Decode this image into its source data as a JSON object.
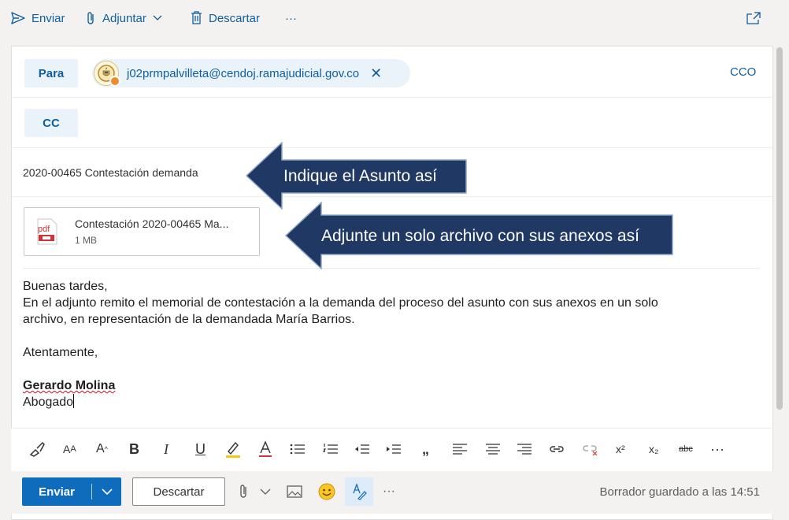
{
  "toolbar": {
    "send": "Enviar",
    "attach": "Adjuntar",
    "discard": "Descartar",
    "more": "···"
  },
  "recipients": {
    "to_label": "Para",
    "cc_label": "CC",
    "bcc_label": "CCO",
    "to_email": "j02prmpalvilleta@cendoj.ramajudicial.gov.co",
    "remove": "✕"
  },
  "subject": "2020-00465 Contestación demanda",
  "attachment": {
    "name": "Contestación 2020-00465 Ma...",
    "size": "1 MB",
    "type": "pdf"
  },
  "callouts": {
    "subject": "Indique el Asunto así",
    "attachment": "Adjunte un solo archivo con sus anexos así"
  },
  "body": {
    "greeting": "Buenas tardes,",
    "line1": "En el adjunto remito el memorial de contestación a la demanda del proceso del asunto con sus anexos en un solo",
    "line2": "archivo, en representación de la demandada María Barrios.",
    "closing": "Atentamente,",
    "sig_name": "Gerardo Molina",
    "sig_title": "Abogado"
  },
  "format_toolbar": {
    "font_size": "A",
    "superscript": "x²",
    "subscript": "x₂",
    "strike": "abc",
    "quote": "„",
    "bold": "B",
    "italic": "I",
    "underline": "U",
    "more": "···"
  },
  "bottom": {
    "send": "Enviar",
    "discard": "Descartar",
    "more": "···",
    "saved": "Borrador guardado a las 14:51"
  },
  "colors": {
    "accent": "#0f6cbd",
    "link": "#0f5e9f",
    "callout": "#1f3864"
  }
}
